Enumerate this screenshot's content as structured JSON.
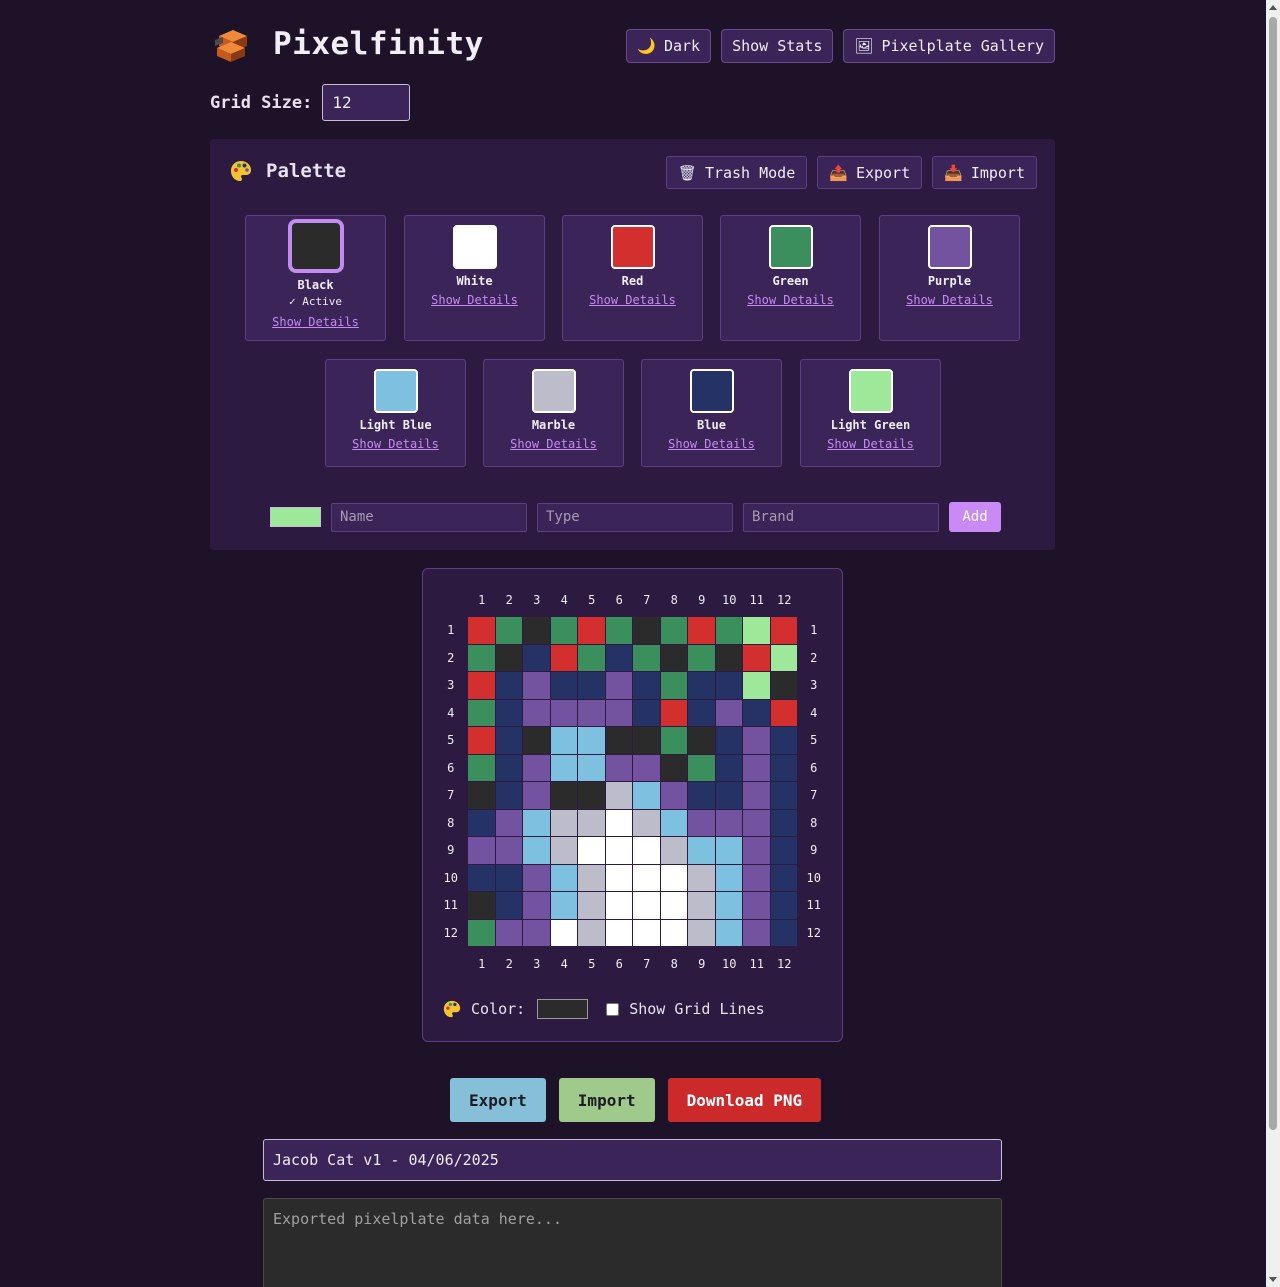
{
  "app": {
    "title": "Pixelfinity",
    "header_buttons": [
      {
        "icon": "moon-icon",
        "glyph": "🌙",
        "label": "Dark"
      },
      {
        "icon": "",
        "glyph": "",
        "label": "Show Stats"
      },
      {
        "icon": "gallery-icon",
        "glyph": "🖼",
        "label": "Pixelplate Gallery"
      }
    ],
    "grid_size_label": "Grid Size:",
    "grid_size_value": "12"
  },
  "palette": {
    "title": "Palette",
    "buttons": [
      {
        "icon": "trash-icon",
        "glyph": "🗑",
        "label": "Trash Mode"
      },
      {
        "icon": "export-tray-icon",
        "glyph": "📤",
        "label": "Export"
      },
      {
        "icon": "import-tray-icon",
        "glyph": "📥",
        "label": "Import"
      }
    ],
    "colors": [
      {
        "name": "Black",
        "hex": "#2b2b2b",
        "active": true,
        "active_label": "✓ Active",
        "link": "Show Details"
      },
      {
        "name": "White",
        "hex": "#ffffff",
        "active": false,
        "link": "Show Details"
      },
      {
        "name": "Red",
        "hex": "#d32f2f",
        "active": false,
        "link": "Show Details"
      },
      {
        "name": "Green",
        "hex": "#3a8f5c",
        "active": false,
        "link": "Show Details"
      },
      {
        "name": "Purple",
        "hex": "#7352a0",
        "active": false,
        "link": "Show Details"
      },
      {
        "name": "Light Blue",
        "hex": "#7ec0e0",
        "active": false,
        "link": "Show Details"
      },
      {
        "name": "Marble",
        "hex": "#bcbcca",
        "active": false,
        "link": "Show Details"
      },
      {
        "name": "Blue",
        "hex": "#243266",
        "active": false,
        "link": "Show Details"
      },
      {
        "name": "Light Green",
        "hex": "#9ee89a",
        "active": false,
        "link": "Show Details"
      }
    ],
    "add_form": {
      "color": "#9ee89a",
      "name_placeholder": "Name",
      "type_placeholder": "Type",
      "brand_placeholder": "Brand",
      "add_label": "Add"
    }
  },
  "board": {
    "size": 12,
    "col_labels": [
      "1",
      "2",
      "3",
      "4",
      "5",
      "6",
      "7",
      "8",
      "9",
      "10",
      "11",
      "12"
    ],
    "row_labels": [
      "1",
      "2",
      "3",
      "4",
      "5",
      "6",
      "7",
      "8",
      "9",
      "10",
      "11",
      "12"
    ],
    "color_map": {
      "K": "#2b2b2b",
      "W": "#ffffff",
      "R": "#d32f2f",
      "G": "#3a8f5c",
      "P": "#7352a0",
      "L": "#7ec0e0",
      "M": "#bcbcca",
      "B": "#243266",
      "N": "#9ee89a"
    },
    "grid": [
      "RGKGRGKGRGNR",
      "GKBRGBGKGKRN",
      "RBPBBPBGBBNK",
      "GBPPPPBRBPBR",
      "RBKLLKKGKBPB",
      "GBPLLPPKGBPB",
      "KBPKKMLPBBPB",
      "BPLMMWMLPPPB",
      "PPLMWWWMLLPB",
      "BBPLMWWWMLPB",
      "KBPLMWWWMLPB",
      "GPPWMWWWMLPB"
    ],
    "color_label": "Color:",
    "current_color": "#2b2b2b",
    "grid_lines_label": "Show Grid Lines",
    "grid_lines_checked": false
  },
  "actions": {
    "export_label": "Export",
    "import_label": "Import",
    "png_label": "Download PNG"
  },
  "plate_name": "Jacob Cat v1 - 04/06/2025",
  "data_placeholder": "Exported pixelplate data here..."
}
